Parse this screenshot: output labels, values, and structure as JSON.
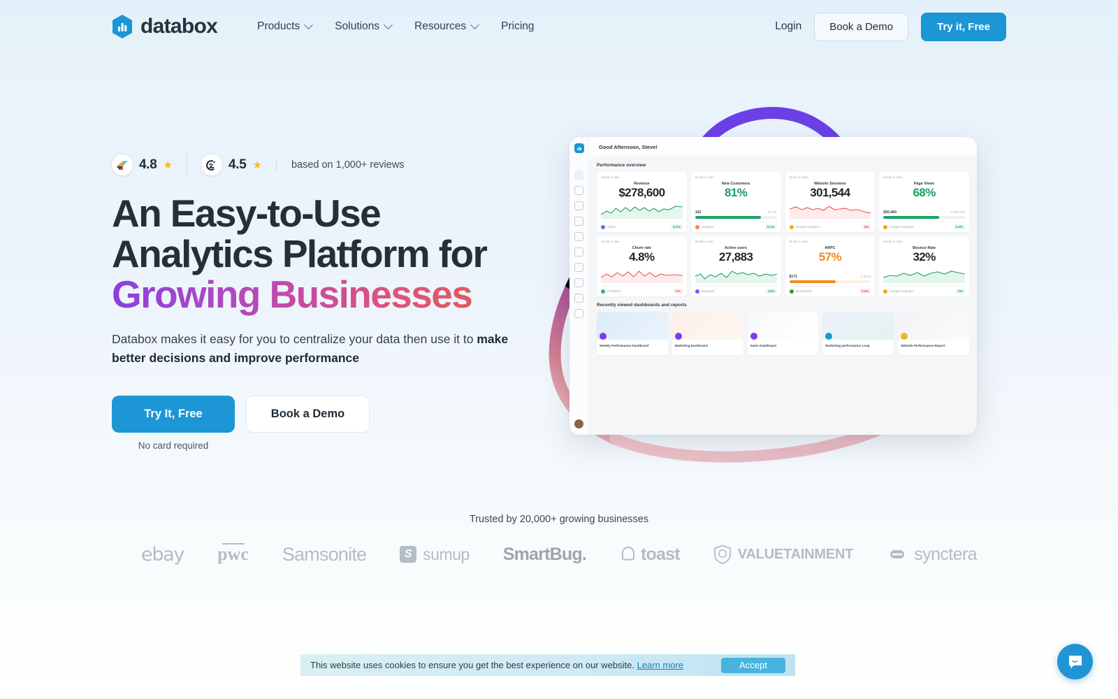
{
  "header": {
    "brand": "databox",
    "brand_icon": "databox-logo-icon",
    "nav": [
      {
        "label": "Products",
        "has_chevron": true
      },
      {
        "label": "Solutions",
        "has_chevron": true
      },
      {
        "label": "Resources",
        "has_chevron": true
      },
      {
        "label": "Pricing",
        "has_chevron": false
      }
    ],
    "login": "Login",
    "book_demo": "Book a Demo",
    "try_free": "Try it, Free"
  },
  "hero": {
    "ratings": [
      {
        "source": "capterra",
        "score": "4.8",
        "star": "★"
      },
      {
        "source": "g2",
        "score": "4.5",
        "star": "★"
      }
    ],
    "reviews_note": "based on 1,000+ reviews",
    "headline_line1": "An Easy-to-Use",
    "headline_line2": "Analytics Platform for",
    "headline_line3": "Growing Businesses",
    "subhead_plain": "Databox makes it easy for you to centralize your data then use it to ",
    "subhead_bold": "make better decisions and improve performance",
    "cta_primary": "Try It, Free",
    "cta_secondary": "Book a Demo",
    "no_card": "No card required",
    "accent_blue": "#1c96d4",
    "gradient_start": "#8b3ee0",
    "gradient_end": "#e05a60"
  },
  "dashboard": {
    "greeting": "Good Afternoon, Steve!",
    "section_performance": "Performance overview",
    "section_recent": "Recently viewed dashboards and reports",
    "sidebar_icons": [
      "home-icon",
      "calendar-icon",
      "chart-icon",
      "target-icon",
      "screen-icon",
      "database-icon",
      "megaphone-icon",
      "chat-icon",
      "clock-icon",
      "network-icon"
    ],
    "sidebar_bottom_icons": [
      "integrations-icon",
      "help-icon",
      "user-avatar"
    ],
    "metrics": [
      {
        "period": "Month to date",
        "title": "Revenue",
        "value": "$278,600",
        "value_color": "dark",
        "viz": "sparkline-green",
        "source": "Stripe",
        "source_color": "#6772e5",
        "delta": "6.1%",
        "dir": "up"
      },
      {
        "period": "Month to date",
        "title": "New Customers",
        "value": "81%",
        "value_color": "green",
        "viz": "progress-green",
        "prog_a": "162",
        "prog_b": "of 200",
        "prog_pct": 81,
        "source": "Hubspot",
        "source_color": "#ff7a59",
        "delta": "5.1%",
        "dir": "up"
      },
      {
        "period": "Month to date",
        "title": "Website Sessions",
        "value": "301,544",
        "value_color": "dark",
        "viz": "sparkline-red",
        "source": "Google Analytics",
        "source_color": "#f5a623",
        "delta": "2%",
        "dir": "down"
      },
      {
        "period": "Month to date",
        "title": "Page Views",
        "value": "68%",
        "value_color": "green",
        "viz": "progress-green",
        "prog_a": "$20,400",
        "prog_b": "of $30,000",
        "prog_pct": 68,
        "source": "Google Analytics",
        "source_color": "#f5a623",
        "delta": "3.4%",
        "dir": "up"
      },
      {
        "period": "Month to date",
        "title": "Churn rate",
        "value": "4.8%",
        "value_color": "dark",
        "viz": "sparkline-red",
        "source": "Profitwell",
        "source_color": "#2bb673",
        "delta": "2%",
        "dir": "down"
      },
      {
        "period": "Month to date",
        "title": "Active users",
        "value": "27,883",
        "value_color": "dark",
        "viz": "sparkline-green",
        "source": "Mixpanel",
        "source_color": "#7856ff",
        "delta": "13%",
        "dir": "up"
      },
      {
        "period": "Month to date",
        "title": "ARPC",
        "value": "57%",
        "value_color": "orange",
        "viz": "progress-orange",
        "prog_a": "$171",
        "prog_b": "of $300",
        "prog_pct": 57,
        "source": "Quickbooks",
        "source_color": "#2ca01c",
        "delta": "3.4%",
        "dir": "down"
      },
      {
        "period": "Month to date",
        "title": "Bounce Rate",
        "value": "32%",
        "value_color": "dark",
        "viz": "sparkline-green",
        "source": "Google Analytics",
        "source_color": "#f5a623",
        "delta": "2%",
        "dir": "up"
      }
    ],
    "recent": [
      {
        "name": "Weekly Performance Dashboard",
        "badge_color": "#7c3aed",
        "thumb": "grid-blue"
      },
      {
        "name": "Marketing Dashboard",
        "badge_color": "#7c3aed",
        "thumb": "grid-peach"
      },
      {
        "name": "Sales Dashboard",
        "badge_color": "#7c3aed",
        "thumb": "grid-white"
      },
      {
        "name": "Marketing performance Loop",
        "badge_color": "#1c96d4",
        "thumb": "cover-teal"
      },
      {
        "name": "Website Performance Report",
        "badge_color": "#f0b429",
        "thumb": "cover-grey"
      }
    ]
  },
  "trusted": {
    "caption": "Trusted by 20,000+ growing businesses",
    "logos": [
      {
        "name": "ebay",
        "type": "ebay"
      },
      {
        "name": "pwc",
        "type": "pwc"
      },
      {
        "name": "Samsonite",
        "type": "samsonite"
      },
      {
        "name": "sumup",
        "type": "sumup"
      },
      {
        "name": "SmartBug.",
        "type": "smartbug"
      },
      {
        "name": "toast",
        "type": "toast"
      },
      {
        "name": "VALUETAINMENT",
        "type": "valuetainment"
      },
      {
        "name": "synctera",
        "type": "synctera"
      }
    ]
  },
  "cookie": {
    "text": "This website uses cookies to ensure you get the best experience on our website.",
    "link": "Learn more",
    "accept": "Accept"
  },
  "chat": {
    "icon": "chat-bubble-icon"
  }
}
